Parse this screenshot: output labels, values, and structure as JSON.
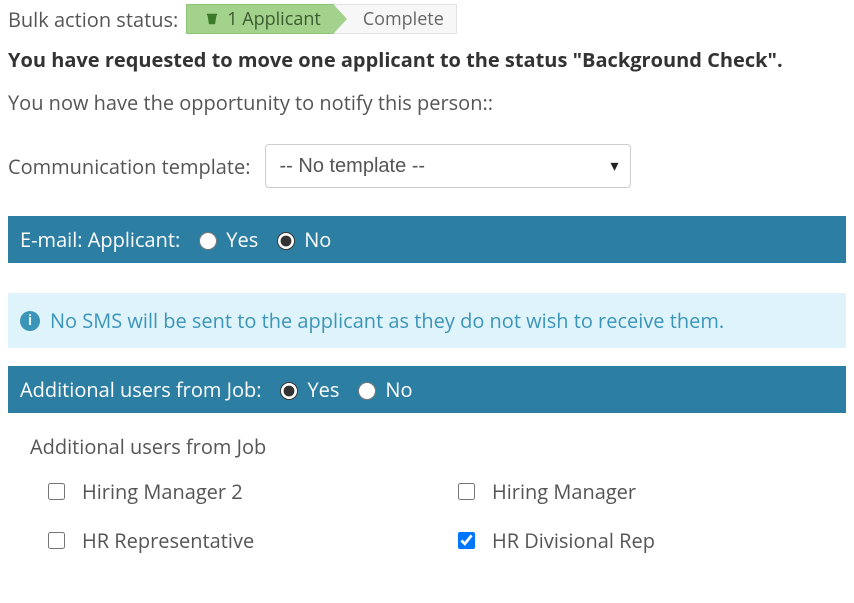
{
  "status": {
    "label": "Bulk action status:",
    "step_active": "1 Applicant",
    "step_next": "Complete"
  },
  "headline": "You have requested to move one applicant to the status \"Background Check\".",
  "notify": "You now have the opportunity to notify this person::",
  "template": {
    "label": "Communication template:",
    "selected": "-- No template --"
  },
  "email_bar": {
    "label": "E-mail: Applicant:",
    "yes": "Yes",
    "no": "No"
  },
  "sms_info": "No SMS will be sent to the applicant as they do not wish to receive them.",
  "users_bar": {
    "label": "Additional users from Job:",
    "yes": "Yes",
    "no": "No"
  },
  "users_panel": {
    "heading": "Additional users from Job",
    "items": [
      {
        "label": "Hiring Manager 2",
        "checked": false
      },
      {
        "label": "Hiring Manager",
        "checked": false
      },
      {
        "label": "HR Representative",
        "checked": false
      },
      {
        "label": "HR Divisional Rep",
        "checked": true
      }
    ]
  }
}
